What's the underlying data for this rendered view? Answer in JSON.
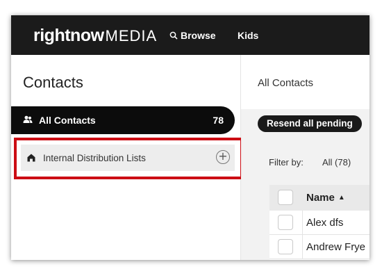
{
  "brand": {
    "logo_strong": "rightnow",
    "logo_light": "MEDIA"
  },
  "nav": {
    "browse": "Browse",
    "kids": "Kids"
  },
  "sidebar": {
    "title": "Contacts",
    "all_contacts": {
      "label": "All Contacts",
      "count": "78",
      "icon": "people-icon"
    },
    "distribution": {
      "label": "Internal Distribution Lists",
      "icon": "home-icon",
      "add_icon": "plus-circle-icon"
    }
  },
  "main": {
    "title": "All Contacts",
    "resend_button": "Resend all pending",
    "filter": {
      "label": "Filter by:",
      "value": "All (78)"
    },
    "table": {
      "columns": [
        "Name"
      ],
      "sort_indicator": "▲",
      "rows": [
        "Alex dfs",
        "Andrew Frye"
      ]
    }
  },
  "colors": {
    "topbar": "#1b1b1b",
    "active_item": "#0c0c0c",
    "highlight_border": "#cc0d14",
    "main_background": "#f2f2f2"
  }
}
